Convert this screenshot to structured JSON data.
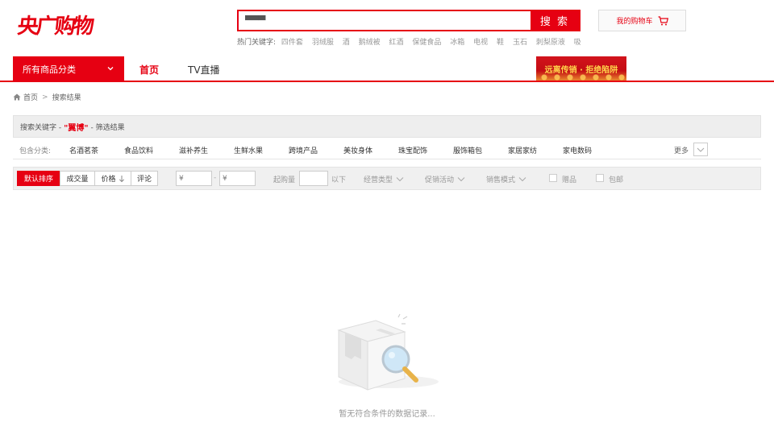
{
  "header": {
    "logo_text": "央广购物",
    "search_value": "▀▀▀",
    "search_button": "搜 索",
    "hotwords_label": "热门关键字:",
    "hotwords": [
      "四件套",
      "羽绒服",
      "酒",
      "鹅绒被",
      "红酒",
      "保健食品",
      "冰箱",
      "电视",
      "鞋",
      "玉石",
      "刺梨原液",
      "吸尘器"
    ],
    "cart_label": "我的购物车"
  },
  "nav": {
    "category_button": "所有商品分类",
    "items": [
      "首页",
      "TV直播"
    ],
    "promo_text": "远离传销 · 拒绝陷阱"
  },
  "breadcrumb": {
    "home": "首页",
    "separator": ">",
    "current": "搜索结果"
  },
  "keyword_bar": {
    "prefix": "搜索关键字 -",
    "keyword": "\"翼博\"",
    "suffix": "- 筛选结果"
  },
  "categories": {
    "label": "包含分类:",
    "items": [
      "名酒茗茶",
      "食品饮料",
      "滋补养生",
      "生鲜水果",
      "跨境产品",
      "美妆身体",
      "珠宝配饰",
      "服饰箱包",
      "家居家纺",
      "家电数码"
    ],
    "more": "更多"
  },
  "filters": {
    "sorts": [
      "默认排序",
      "成交量",
      "价格",
      "评论"
    ],
    "active_sort": "默认排序",
    "price_from_placeholder": "¥",
    "price_to_placeholder": "¥",
    "price_sep": "-",
    "min_qty_label": "起购量",
    "min_qty_suffix": "以下",
    "dropdowns": [
      "经营类型",
      "促销活动",
      "销售模式"
    ],
    "checkboxes": [
      "赠品",
      "包邮"
    ]
  },
  "empty_state": {
    "message": "暂无符合条件的数据记录..."
  },
  "colors": {
    "brand_red": "#e60012"
  }
}
